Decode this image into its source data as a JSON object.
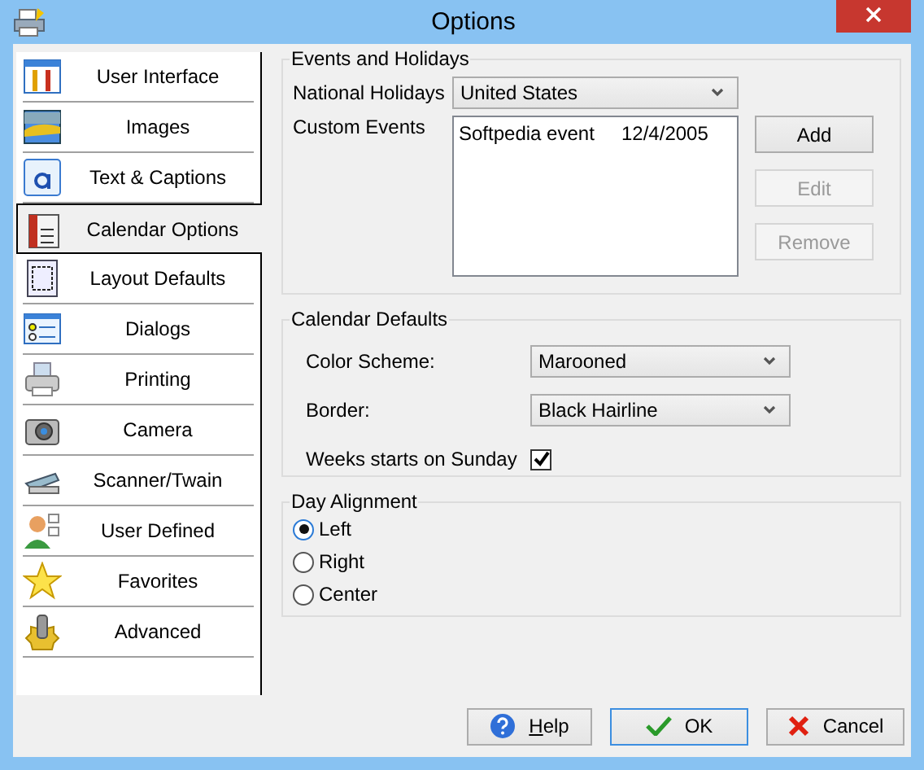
{
  "window": {
    "title": "Options"
  },
  "sidebar": {
    "items": [
      {
        "label": "User Interface",
        "selected": false
      },
      {
        "label": "Images",
        "selected": false
      },
      {
        "label": "Text & Captions",
        "selected": false
      },
      {
        "label": "Calendar Options",
        "selected": true
      },
      {
        "label": "Layout Defaults",
        "selected": false
      },
      {
        "label": "Dialogs",
        "selected": false
      },
      {
        "label": "Printing",
        "selected": false
      },
      {
        "label": "Camera",
        "selected": false
      },
      {
        "label": "Scanner/Twain",
        "selected": false
      },
      {
        "label": "User Defined",
        "selected": false
      },
      {
        "label": "Favorites",
        "selected": false
      },
      {
        "label": "Advanced",
        "selected": false
      }
    ]
  },
  "events_and_holidays": {
    "title": "Events and Holidays",
    "national_holidays_label": "National Holidays",
    "national_holidays_value": "United States",
    "custom_events_label": "Custom Events",
    "custom_events": [
      {
        "name": "Softpedia event",
        "date": "12/4/2005"
      }
    ],
    "buttons": [
      {
        "label": "Add",
        "disabled": false
      },
      {
        "label": "Edit",
        "disabled": true
      },
      {
        "label": "Remove",
        "disabled": true
      }
    ]
  },
  "calendar_defaults": {
    "title": "Calendar Defaults",
    "color_scheme_label": "Color Scheme:",
    "color_scheme_value": "Marooned",
    "border_label": "Border:",
    "border_value": "Black Hairline",
    "weeks_start_label": "Weeks starts on Sunday",
    "weeks_start_checked": true
  },
  "day_alignment": {
    "title": "Day Alignment",
    "options": [
      {
        "label": "Left",
        "selected": true
      },
      {
        "label": "Right",
        "selected": false
      },
      {
        "label": "Center",
        "selected": false
      }
    ]
  },
  "buttons": [
    {
      "label": "Help",
      "kind": "help"
    },
    {
      "label": "OK",
      "kind": "ok"
    },
    {
      "label": "Cancel",
      "kind": "cancel"
    }
  ]
}
